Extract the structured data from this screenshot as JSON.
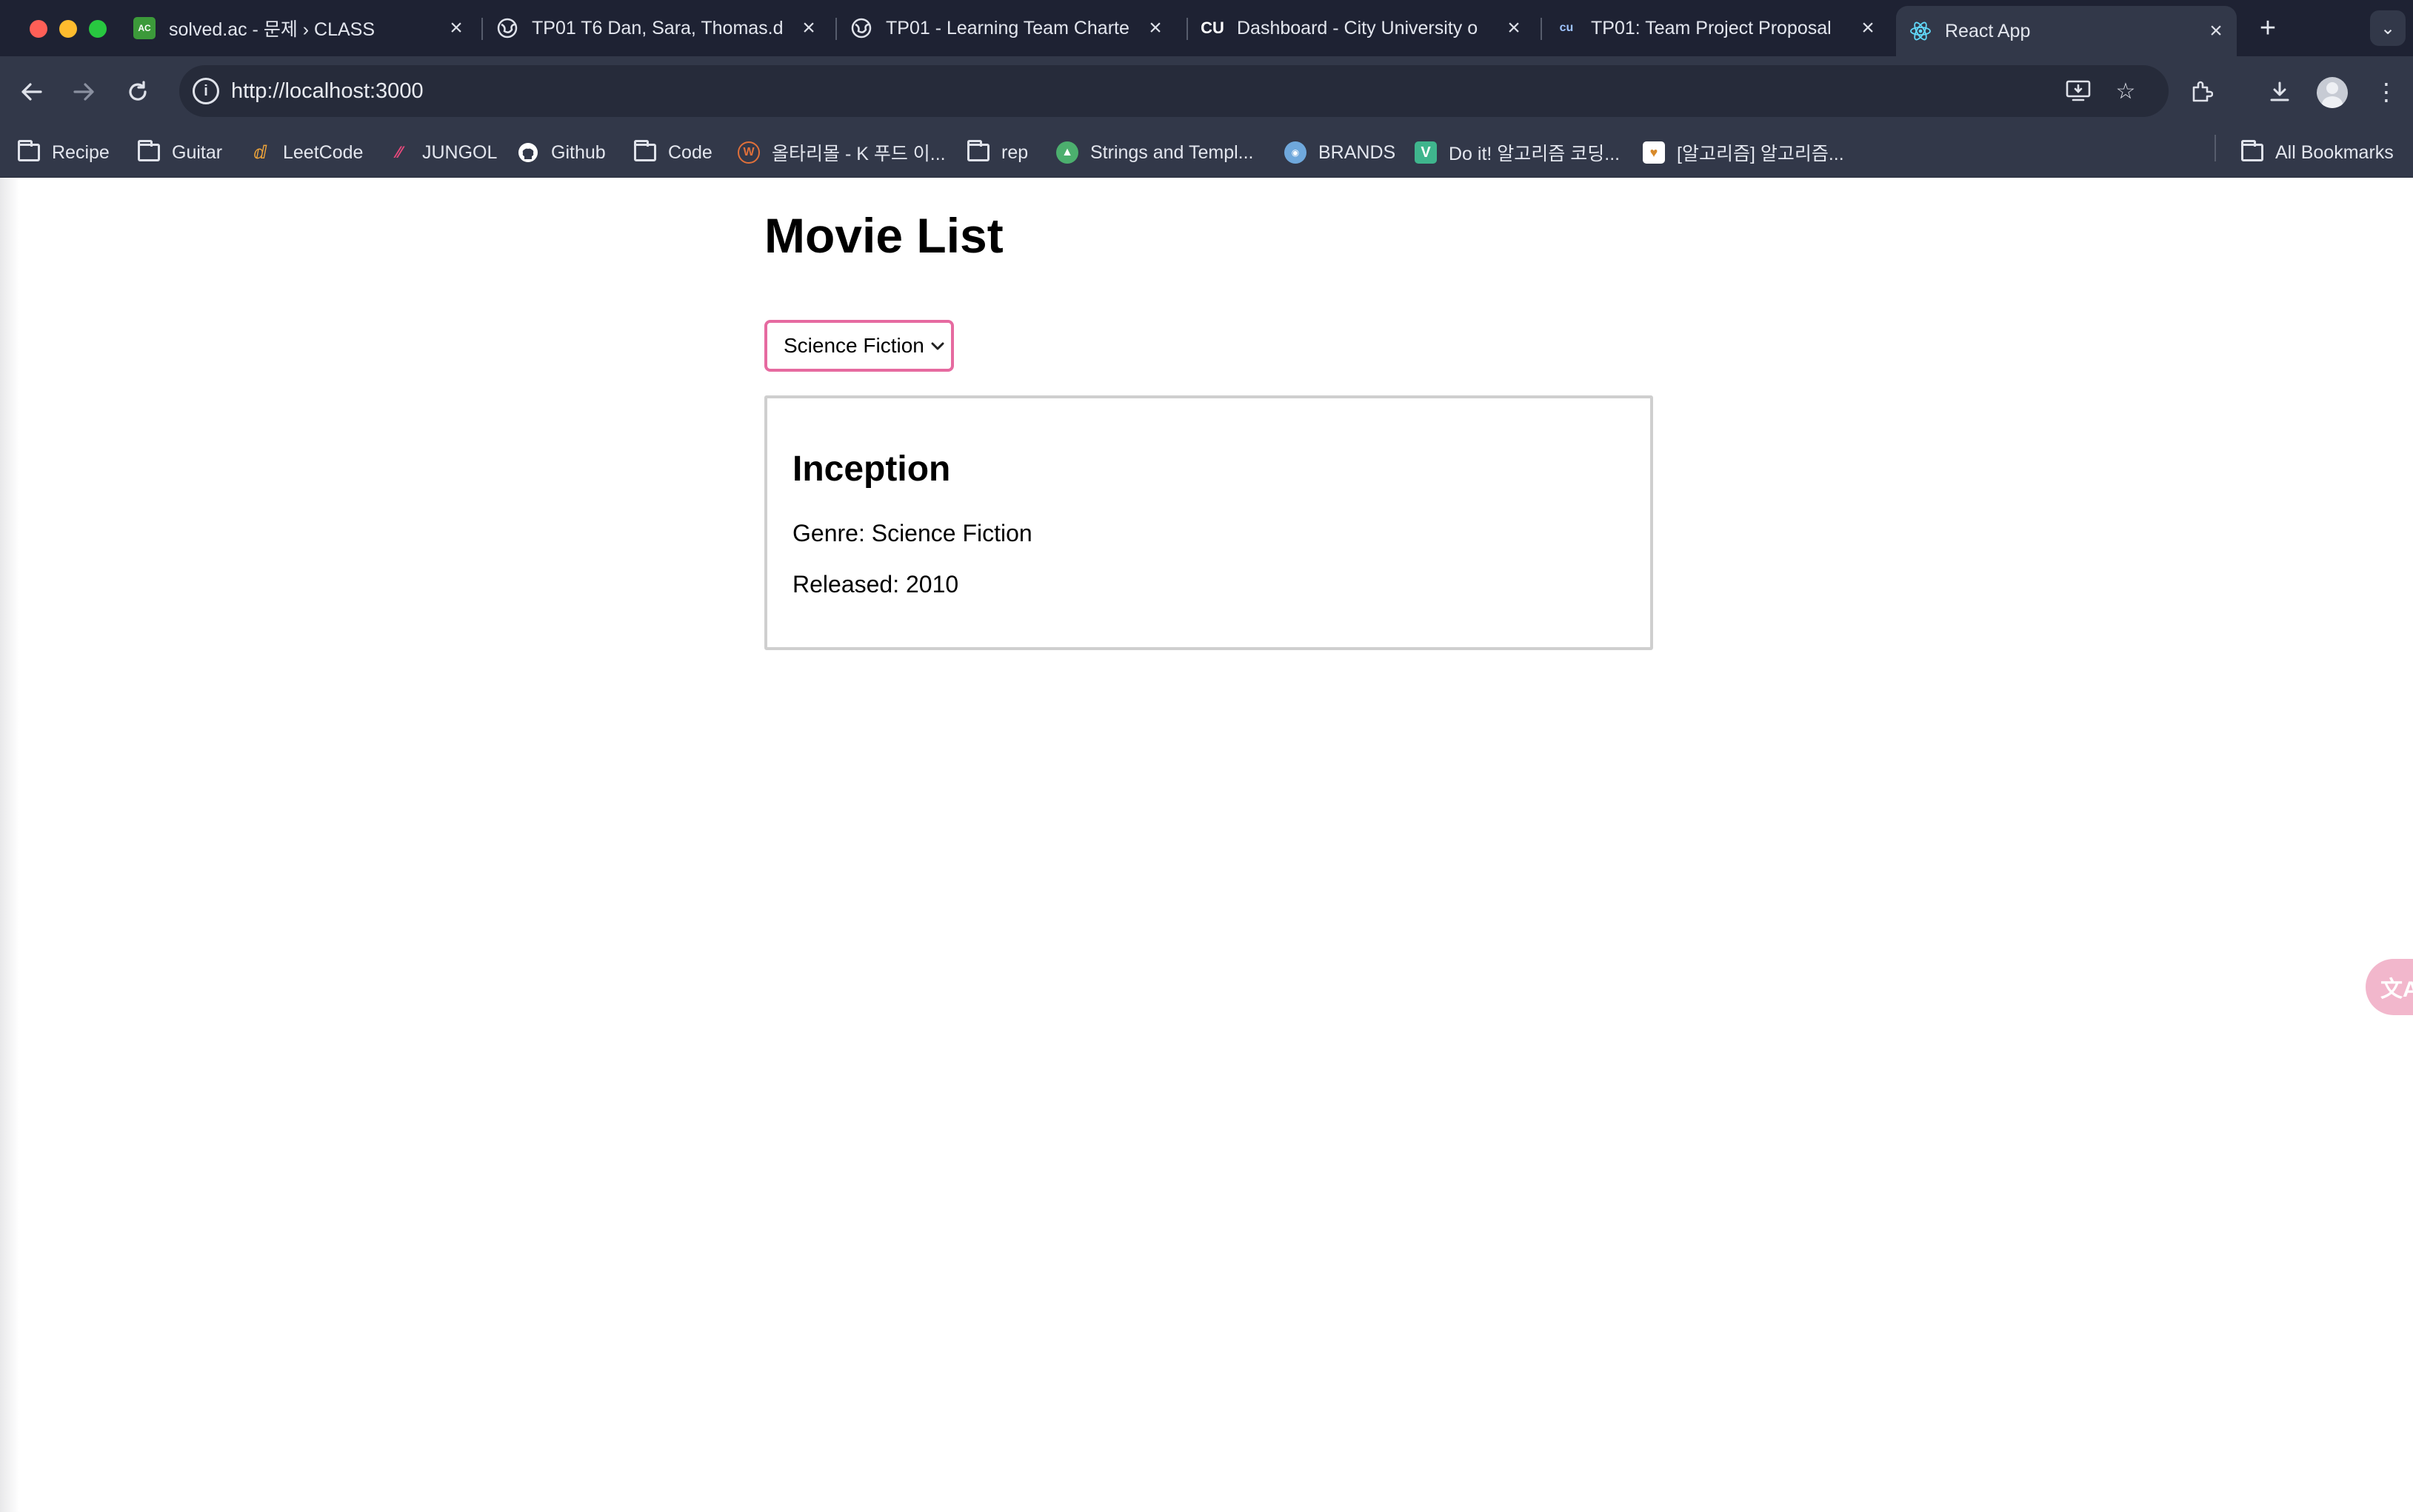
{
  "window": {
    "tabs": [
      {
        "title": "solved.ac - 문제 › CLASS",
        "favicon": "solved-ac-icon",
        "favicon_text": "AC",
        "favicon_color": "#3c9a3a",
        "active": false
      },
      {
        "title": "TP01 T6 Dan, Sara, Thomas.d",
        "favicon": "globe-icon",
        "active": false
      },
      {
        "title": "TP01 - Learning Team Charte",
        "favicon": "globe-icon",
        "active": false
      },
      {
        "title": "Dashboard - City University o",
        "favicon": "cu-icon",
        "favicon_text": "CU",
        "active": false
      },
      {
        "title": "TP01: Team Project Proposal",
        "favicon": "cu-icon",
        "favicon_text": "cu",
        "active": false
      },
      {
        "title": "React App",
        "favicon": "react-icon",
        "active": true
      }
    ],
    "new_tab_label": "+"
  },
  "toolbar": {
    "url": "http://localhost:3000"
  },
  "bookmarks": {
    "items": [
      {
        "label": "Recipe",
        "icon": "folder-icon"
      },
      {
        "label": "Guitar",
        "icon": "folder-icon"
      },
      {
        "label": "LeetCode",
        "icon": "leetcode-icon"
      },
      {
        "label": "JUNGOL",
        "icon": "jungol-icon"
      },
      {
        "label": "Github",
        "icon": "github-icon"
      },
      {
        "label": "Code",
        "icon": "folder-icon"
      },
      {
        "label": "올타리몰 - K 푸드 이...",
        "icon": "w-circle-icon"
      },
      {
        "label": "rep",
        "icon": "folder-icon"
      },
      {
        "label": "Strings and Templ...",
        "icon": "triangle-icon"
      },
      {
        "label": "BRANDS",
        "icon": "brands-icon"
      },
      {
        "label": "Do it! 알고리즘 코딩...",
        "icon": "v-icon"
      },
      {
        "label": "[알고리즘] 알고리즘...",
        "icon": "book-icon"
      }
    ],
    "all_bookmarks_label": "All Bookmarks"
  },
  "page": {
    "title": "Movie List",
    "genre_select": {
      "selected": "Science Fiction"
    },
    "movies": [
      {
        "title": "Inception",
        "genre_line": "Genre: Science Fiction",
        "released_line": "Released: 2010"
      }
    ]
  },
  "colors": {
    "select_border": "#e66aa0",
    "card_border": "#cfcfcf",
    "titlebar_bg": "#1e2233",
    "toolbar_bg": "#323849"
  }
}
